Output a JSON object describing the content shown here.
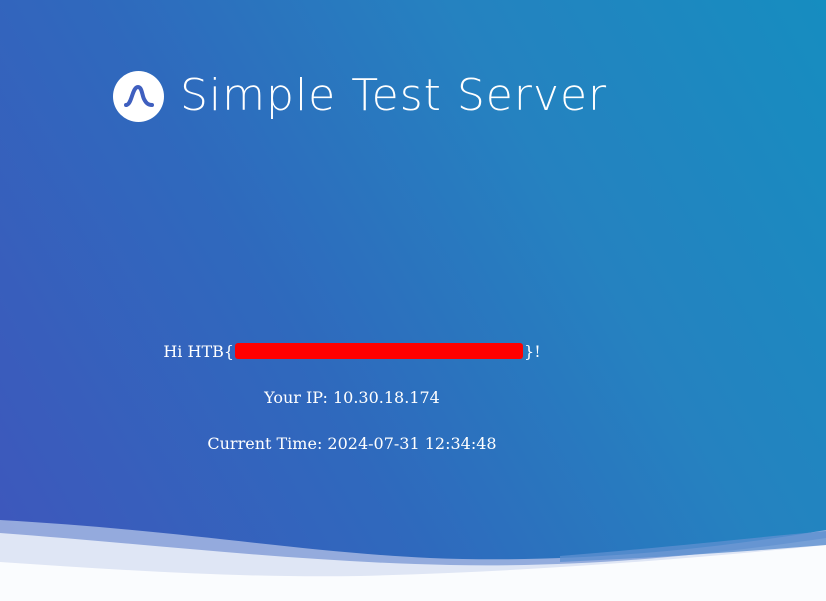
{
  "app": {
    "title": "Simple Test Server",
    "logo_icon": "wave-s-icon"
  },
  "message": {
    "greeting_prefix": "Hi HTB{",
    "greeting_suffix": "}!",
    "redaction_color": "#ff0000",
    "ip_line": "Your IP: 10.30.18.174",
    "time_line": "Current Time: 2024-07-31 12:34:48"
  },
  "theme": {
    "gradient_start": "#3f56bc",
    "gradient_end": "#168dc0",
    "text_color": "#ffffff"
  }
}
